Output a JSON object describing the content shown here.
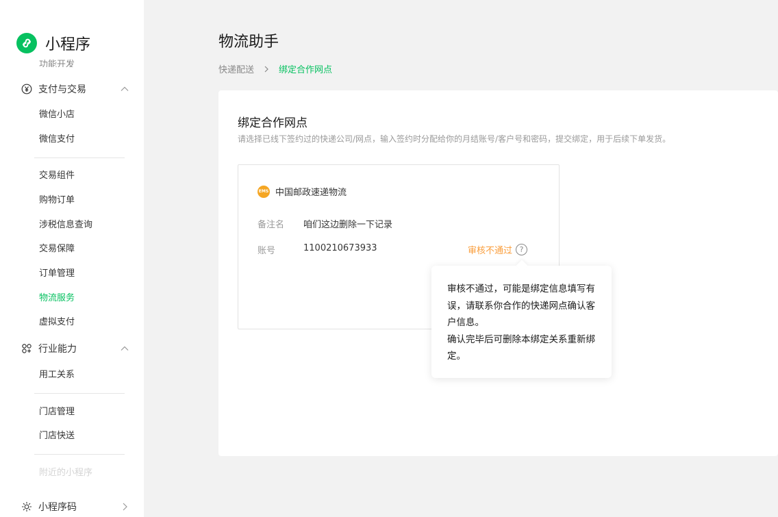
{
  "app": {
    "name": "小程序",
    "brand_color": "#07c160"
  },
  "sidebar": {
    "cut_item": "功能开发",
    "groups": [
      {
        "label": "支付与交易",
        "icon": "yen-circle-icon",
        "items": [
          "微信小店",
          "微信支付",
          "交易组件",
          "购物订单",
          "涉税信息查询",
          "交易保障",
          "订单管理",
          "物流服务",
          "虚拟支付"
        ],
        "active": "物流服务"
      },
      {
        "label": "行业能力",
        "icon": "industry-icon",
        "items": [
          "用工关系",
          "门店管理",
          "门店快送",
          "附近的小程序"
        ]
      },
      {
        "label": "小程序码",
        "icon": "sun-icon"
      }
    ]
  },
  "page": {
    "title": "物流助手",
    "breadcrumb": [
      "快递配送",
      "绑定合作网点"
    ]
  },
  "panel": {
    "title": "绑定合作网点",
    "description": "请选择已线下签约过的快递公司/网点，输入签约时分配给你的月结账号/客户号和密码，提交绑定，用于后续下单发货。"
  },
  "card": {
    "company": "中国邮政速递物流",
    "company_logo_text": "EMS",
    "remark_label": "备注名",
    "remark_value": "咱们这边删除一下记录",
    "account_label": "账号",
    "account_value": "1100210673933",
    "status": "审核不通过",
    "status_color": "#fa9d3b"
  },
  "tooltip": {
    "line1": "审核不通过，可能是绑定信息填写有误，请联系你合作的快递网点确认客户信息。",
    "line2": "确认完毕后可删除本绑定关系重新绑定。"
  }
}
